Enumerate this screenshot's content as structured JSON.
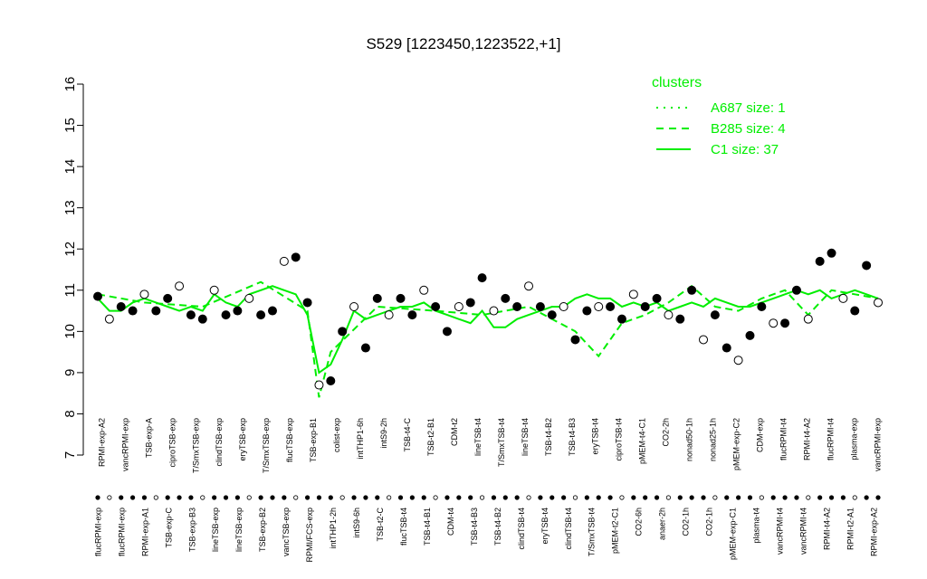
{
  "chart_data": {
    "type": "line",
    "title": "S529 [1223450,1223522,+1]",
    "xlabel": "",
    "ylabel": "",
    "ylim": [
      7,
      16
    ],
    "yticks": [
      7,
      8,
      9,
      10,
      11,
      12,
      13,
      14,
      15,
      16
    ],
    "grid": false,
    "legend": {
      "title": "clusters",
      "placement": "top-right",
      "entries": [
        {
          "label": "A687 size: 1",
          "style": "dotted"
        },
        {
          "label": "B285 size: 4",
          "style": "dashed"
        },
        {
          "label": "C1 size: 37",
          "style": "solid"
        }
      ]
    },
    "line_color": "#00ee00",
    "x_top_labels": [
      "RPMI-exp-A2",
      "vancRPMI-exp",
      "TSB-exp-A",
      "ciproTSB-exp",
      "T/SmxTSB-exp",
      "clindTSB-exp",
      "eryTSB-exp",
      "T/SmxTSB-exp",
      "flucTSB-exp",
      "TSB-exp-B1",
      "colist-exp",
      "intTHP1-6h",
      "intS9-2h",
      "TSB-t4-C",
      "TSB-t2-B1",
      "CDM-t2",
      "lineTSB-t4",
      "T/SmxTSB-t4",
      "lineTSB-t4",
      "TSB-t4-B2",
      "TSB-t4-B3",
      "eryTSB-t4",
      "ciproTSB-t4",
      "pMEM-t4-C1",
      "CO2-2h",
      "nonad50-1h",
      "nonad25-1h",
      "pMEM-exp-C2",
      "CDM-exp",
      "flucRPMI-t4",
      "RPMI-t4-A2",
      "flucRPMI-t4",
      "plasma-exp",
      "vancRPMI-exp"
    ],
    "x_bottom_labels": [
      "flucRPMI-exp",
      "flucRPMI-exp",
      "RPMI-exp-A1",
      "TSB-exp-C",
      "TSB-exp-B3",
      "lineTSB-exp",
      "lineTSB-exp",
      "TSB-exp-B2",
      "vancTSB-exp",
      "RPMI/FCS-exp",
      "intTHP1-2h",
      "intS9-6h",
      "TSB-t2-C",
      "flucTSB-t4",
      "TSB-t4-B1",
      "CDM-t4",
      "TSB-t4-B3",
      "TSB-t4-B2",
      "clindTSB-t4",
      "eryTSB-t4",
      "clindTSB-t4",
      "T/SmxTSB-t4",
      "pMEM-t2-C1",
      "CO2-6h",
      "anaer-2h",
      "CO2-1h",
      "CO2-1h",
      "pMEM-exp-C1",
      "plasma-t4",
      "vancRPMI-t4",
      "vancRPMI-t4",
      "RPMI-t4-A2",
      "RPMI-t2-A1",
      "RPMI-exp-A2"
    ],
    "series": [
      {
        "style": "solid",
        "x": [
          1,
          2,
          3,
          4,
          5,
          6,
          7,
          8,
          9,
          10,
          11,
          12,
          13,
          14,
          15,
          16,
          17,
          18,
          19,
          20,
          21,
          22,
          23,
          24,
          25,
          26,
          27,
          28,
          29,
          30,
          31,
          32,
          33,
          34,
          35,
          36,
          37,
          38,
          39,
          40,
          41,
          42,
          43,
          44,
          45,
          46,
          47,
          48,
          49,
          50,
          51,
          52,
          53,
          54,
          55,
          56,
          57,
          58,
          59,
          60,
          61,
          62,
          63,
          64,
          65,
          66,
          67,
          68
        ],
        "values": [
          10.8,
          10.5,
          10.5,
          10.7,
          10.8,
          10.7,
          10.6,
          10.5,
          10.6,
          10.5,
          10.9,
          10.7,
          10.6,
          10.9,
          11.0,
          11.1,
          11.0,
          10.9,
          10.4,
          9.0,
          9.2,
          9.8,
          10.5,
          10.3,
          10.4,
          10.5,
          10.6,
          10.6,
          10.7,
          10.5,
          10.4,
          10.3,
          10.2,
          10.5,
          10.1,
          10.1,
          10.3,
          10.4,
          10.5,
          10.6,
          10.6,
          10.8,
          10.9,
          10.8,
          10.8,
          10.6,
          10.7,
          10.6,
          10.7,
          10.5,
          10.6,
          10.7,
          10.6,
          10.8,
          10.7,
          10.6,
          10.6,
          10.7,
          10.8,
          10.9,
          11.0,
          10.9,
          11.0,
          10.8,
          10.9,
          11.0,
          10.9,
          10.8
        ]
      },
      {
        "style": "dashed",
        "x": [
          1,
          5,
          10,
          15,
          19,
          20,
          21,
          25,
          30,
          34,
          38,
          42,
          44,
          46,
          48,
          50,
          52,
          54,
          56,
          58,
          60,
          62,
          64,
          66,
          68
        ],
        "values": [
          10.9,
          10.7,
          10.6,
          11.2,
          10.5,
          8.4,
          9.5,
          10.6,
          10.5,
          10.4,
          10.6,
          10.0,
          9.4,
          10.2,
          10.4,
          10.7,
          11.1,
          10.6,
          10.5,
          10.8,
          11.0,
          10.4,
          11.0,
          10.9,
          10.8
        ]
      }
    ],
    "points": {
      "x": [
        1,
        2,
        3,
        4,
        5,
        6,
        7,
        8,
        9,
        10,
        11,
        12,
        13,
        14,
        15,
        16,
        17,
        18,
        19,
        20,
        21,
        22,
        23,
        24,
        25,
        26,
        27,
        28,
        29,
        30,
        31,
        32,
        33,
        34,
        35,
        36,
        37,
        38,
        39,
        40,
        41,
        42,
        43,
        44,
        45,
        46,
        47,
        48,
        49,
        50,
        51,
        52,
        53,
        54,
        55,
        56,
        57,
        58,
        59,
        60,
        61,
        62,
        63,
        64,
        65,
        66,
        67,
        68
      ],
      "values": [
        10.85,
        10.3,
        10.6,
        10.5,
        10.9,
        10.5,
        10.8,
        11.1,
        10.4,
        10.3,
        11.0,
        10.4,
        10.5,
        10.8,
        10.4,
        10.5,
        11.7,
        11.8,
        10.7,
        8.7,
        8.8,
        10.0,
        10.6,
        9.6,
        10.8,
        10.4,
        10.8,
        10.4,
        11.0,
        10.6,
        10.0,
        10.6,
        10.7,
        11.3,
        10.5,
        10.8,
        10.6,
        11.1,
        10.6,
        10.4,
        10.6,
        9.8,
        10.5,
        10.6,
        10.6,
        10.3,
        10.9,
        10.6,
        10.8,
        10.4,
        10.3,
        11.0,
        9.8,
        10.4,
        9.6,
        9.3,
        9.9,
        10.6,
        10.2,
        10.2,
        11.0,
        10.3,
        11.7,
        11.9,
        10.8,
        10.5,
        11.6,
        10.7
      ]
    },
    "n_points": 68
  }
}
